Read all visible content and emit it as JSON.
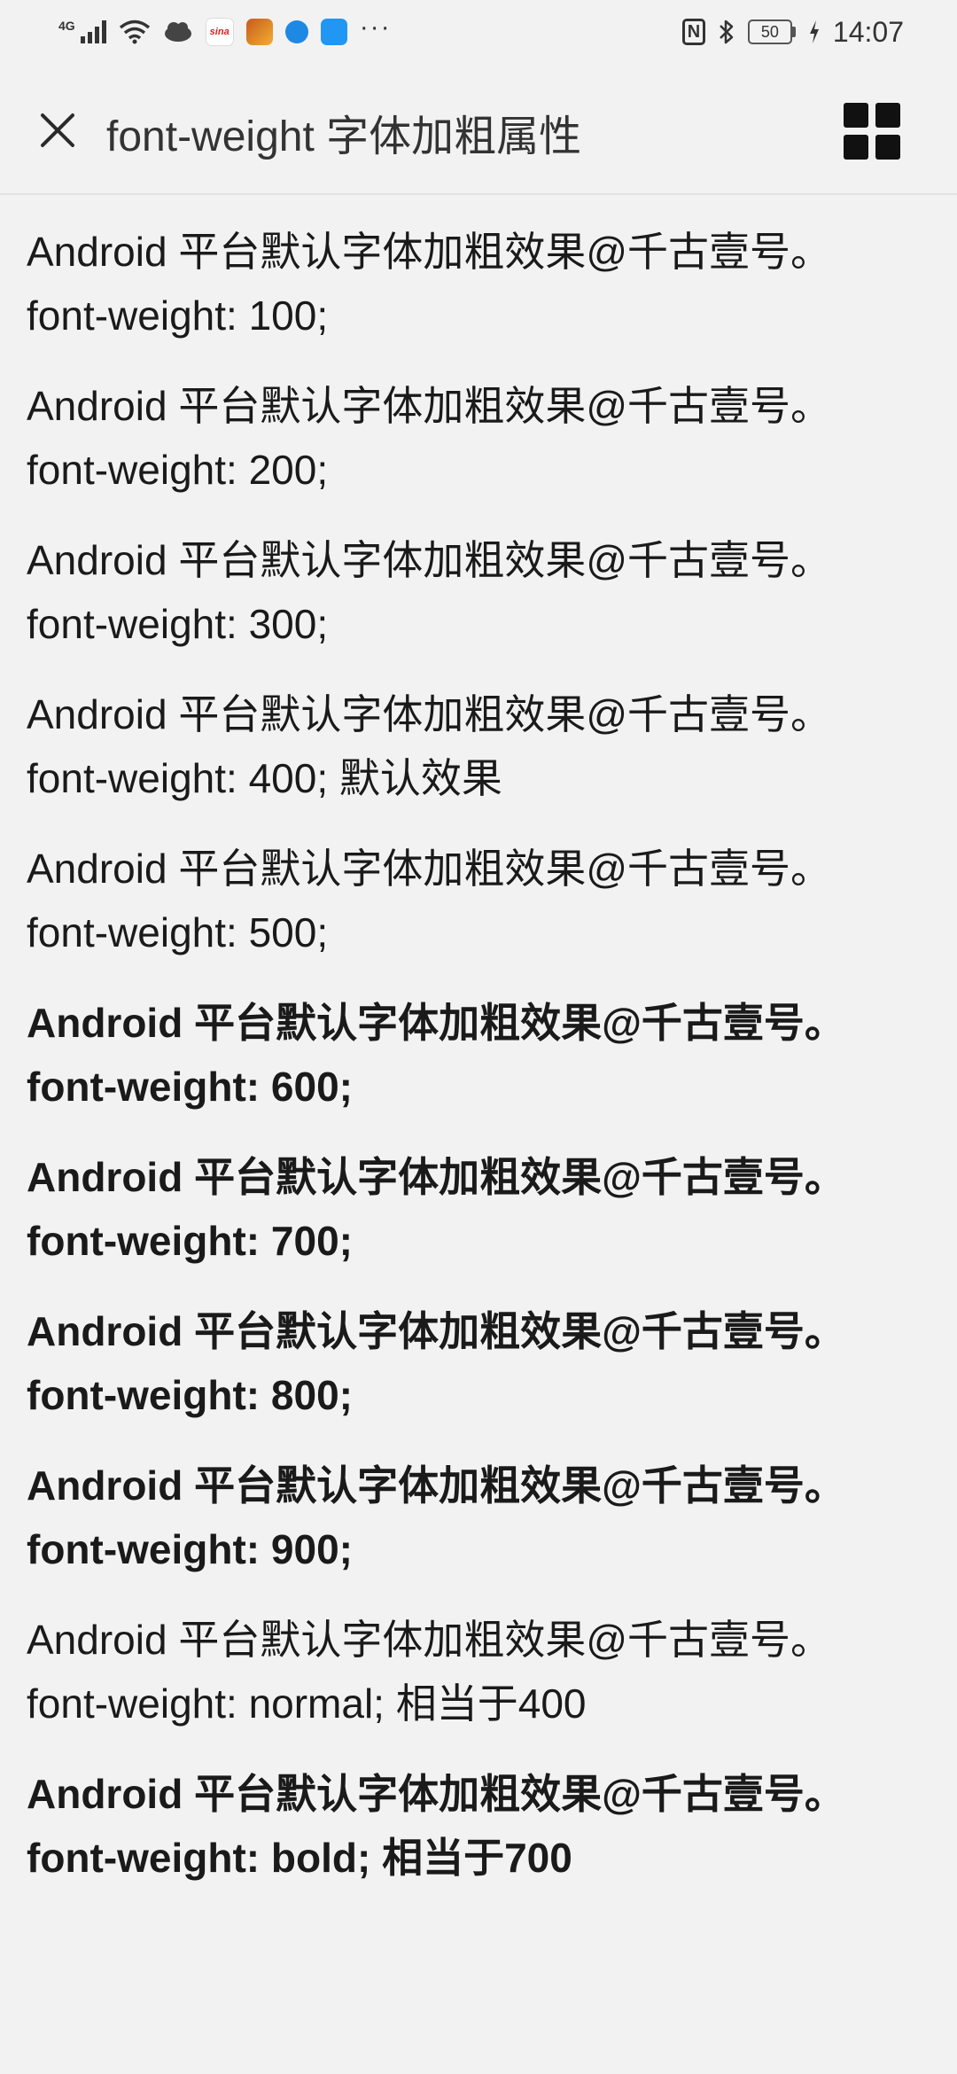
{
  "status_bar": {
    "network": "4G",
    "time": "14:07",
    "battery": "50",
    "more": "···"
  },
  "header": {
    "title": "font-weight 字体加粗属性"
  },
  "entries": [
    {
      "text": "Android 平台默认字体加粗效果@千古壹号。",
      "rule": "font-weight: 100;",
      "weight": 100
    },
    {
      "text": "Android 平台默认字体加粗效果@千古壹号。",
      "rule": "font-weight: 200;",
      "weight": 200
    },
    {
      "text": "Android 平台默认字体加粗效果@千古壹号。",
      "rule": "font-weight: 300;",
      "weight": 300
    },
    {
      "text": "Android 平台默认字体加粗效果@千古壹号。",
      "rule": "font-weight: 400; 默认效果",
      "weight": 400
    },
    {
      "text": "Android 平台默认字体加粗效果@千古壹号。",
      "rule": "font-weight: 500;",
      "weight": 500
    },
    {
      "text": "Android 平台默认字体加粗效果@千古壹号。",
      "rule": "font-weight: 600;",
      "weight": 600
    },
    {
      "text": "Android 平台默认字体加粗效果@千古壹号。",
      "rule": "font-weight: 700;",
      "weight": 700
    },
    {
      "text": "Android 平台默认字体加粗效果@千古壹号。",
      "rule": "font-weight: 800;",
      "weight": 800
    },
    {
      "text": "Android 平台默认字体加粗效果@千古壹号。",
      "rule": "font-weight: 900;",
      "weight": 900
    },
    {
      "text": "Android 平台默认字体加粗效果@千古壹号。",
      "rule": "font-weight: normal; 相当于400",
      "weight": "normal"
    },
    {
      "text": "Android 平台默认字体加粗效果@千古壹号。",
      "rule": "font-weight: bold; 相当于700",
      "weight": "bold"
    }
  ]
}
